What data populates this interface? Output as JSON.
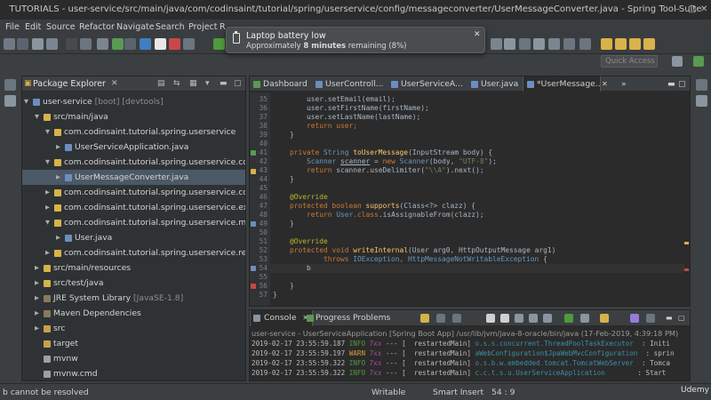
{
  "window": {
    "title": "TUTORIALS - user-service/src/main/java/com/codinsaint/tutorial/spring/userservice/config/messageconverter/UserMessageConverter.java - Spring Tool Suite"
  },
  "menu": [
    "File",
    "Edit",
    "Source",
    "Refactor",
    "Navigate",
    "Search",
    "Project",
    "R"
  ],
  "notification": {
    "title": "Laptop battery low",
    "message_prefix": "Approximately ",
    "message_bold": "8 minutes",
    "message_suffix": " remaining (8%)"
  },
  "quick_access": {
    "placeholder": "Quick Access"
  },
  "package_explorer": {
    "title": "Package Explorer",
    "rows": [
      {
        "label": "user-service",
        "suffix": " [boot] [devtools]"
      },
      {
        "label": "src/main/java",
        "suffix": ""
      },
      {
        "label": "com.codinsaint.tutorial.spring.userservice",
        "suffix": ""
      },
      {
        "label": "UserServiceApplication.java",
        "suffix": ""
      },
      {
        "label": "com.codinsaint.tutorial.spring.userservice.config.mess",
        "suffix": ""
      },
      {
        "label": "UserMessageConverter.java",
        "suffix": ""
      },
      {
        "label": "com.codinsaint.tutorial.spring.userservice.controller",
        "suffix": ""
      },
      {
        "label": "com.codinsaint.tutorial.spring.userservice.exception",
        "suffix": ""
      },
      {
        "label": "com.codinsaint.tutorial.spring.userservice.model",
        "suffix": ""
      },
      {
        "label": "User.java",
        "suffix": ""
      },
      {
        "label": "com.codinsaint.tutorial.spring.userservice.repository",
        "suffix": ""
      },
      {
        "label": "src/main/resources",
        "suffix": ""
      },
      {
        "label": "src/test/java",
        "suffix": ""
      },
      {
        "label": "JRE System Library",
        "suffix": " [JavaSE-1.8]"
      },
      {
        "label": "Maven Dependencies",
        "suffix": ""
      },
      {
        "label": "src",
        "suffix": ""
      },
      {
        "label": "target",
        "suffix": ""
      },
      {
        "label": "mvnw",
        "suffix": ""
      },
      {
        "label": "mvnw.cmd",
        "suffix": ""
      }
    ]
  },
  "editor": {
    "tabs": [
      "Dashboard",
      "UserControll...",
      "UserServiceA...",
      "User.java",
      "*UserMessage..."
    ],
    "line_numbers": [
      "35",
      "36",
      "37",
      "38",
      "39",
      "40",
      "41",
      "42",
      "43",
      "44",
      "45",
      "46",
      "47",
      "48",
      "49",
      "50",
      "51",
      "52",
      "53",
      "54",
      "55",
      "56",
      "57"
    ],
    "code": {
      "l35": "user.setEmail(email);",
      "l36": "user.setFirstName(firstName);",
      "l37": "user.setLastName(lastName);",
      "l38": "return user;",
      "l39": "}",
      "l41_kw": "private ",
      "l41_ty": "String ",
      "l41_fn": "toUserMessage",
      "l41_rest": "(InputStream body) {",
      "l42_ty": "Scanner ",
      "l42_var": "scanner",
      "l42_mid": " = ",
      "l42_kw": "new ",
      "l42_ty2": "Scanner",
      "l42_a": "(body, ",
      "l42_st": "\"UTF-8\"",
      "l42_b": ");",
      "l43_kw": "return ",
      "l43_a": "scanner.useDelimiter(",
      "l43_st": "\"\\\\A\"",
      "l43_b": ").next();",
      "l44": "}",
      "l46": "@Override",
      "l47_kw": "protected boolean ",
      "l47_fn": "supports",
      "l47_a": "(Class<?> clazz) {",
      "l48_kw": "return ",
      "l48_ty": "User",
      "l48_kw2": ".class",
      "l48_a": ".isAssignableFrom(clazz);",
      "l49": "}",
      "l51": "@Override",
      "l52_kw": "protected void ",
      "l52_fn": "writeInternal",
      "l52_a": "(User arg0, HttpOutputMessage arg1)",
      "l53_kw": "throws ",
      "l53_ty": "IOException, HttpMessageNotWritableException",
      "l53_b": " {",
      "l54": "b",
      "l56": "}",
      "l57": "}"
    }
  },
  "console": {
    "tabs": [
      "Console",
      "Progress",
      "Problems"
    ],
    "description": "user-service - UserServiceApplication [Spring Boot App] /usr/lib/jvm/java-8-oracle/bin/java (17-Feb-2019, 4:39:18 PM)",
    "rows": [
      {
        "ts": "2019-02-17 23:55:59.187",
        "level": "INFO",
        "pid": "7xx",
        "sep": " --- [",
        "thread": "  restartedMain]",
        "logger": " o.s.s.concurrent.ThreadPoolTaskExecutor",
        "msg": "  : Initi"
      },
      {
        "ts": "2019-02-17 23:55:59.197",
        "level": "WARN",
        "pid": "7xx",
        "sep": " --- [",
        "thread": "  restartedMain]",
        "logger": " aWebConfiguration$JpaWebMvcConfiguration",
        "msg": "  : sprin"
      },
      {
        "ts": "2019-02-17 23:55:59.322",
        "level": "INFO",
        "pid": "7xx",
        "sep": " --- [",
        "thread": "  restartedMain]",
        "logger": " o.s.b.w.embedded.tomcat.TomcatWebServer",
        "msg": "  : Tomca"
      },
      {
        "ts": "2019-02-17 23:55:59.322",
        "level": "INFO",
        "pid": "7xx",
        "sep": " --- [",
        "thread": "  restartedMain]",
        "logger": " c.c.t.s.u.UserServiceApplication",
        "msg": "        : Start"
      }
    ]
  },
  "status": {
    "message": "b cannot be resolved",
    "mode": "Writable",
    "insert": "Smart Insert",
    "position": "54 : 9",
    "brand": "Udemy"
  },
  "colors": {
    "accent": "#4b5866",
    "keyword": "#cc7832",
    "string": "#6a8759",
    "method": "#ffc66d"
  }
}
